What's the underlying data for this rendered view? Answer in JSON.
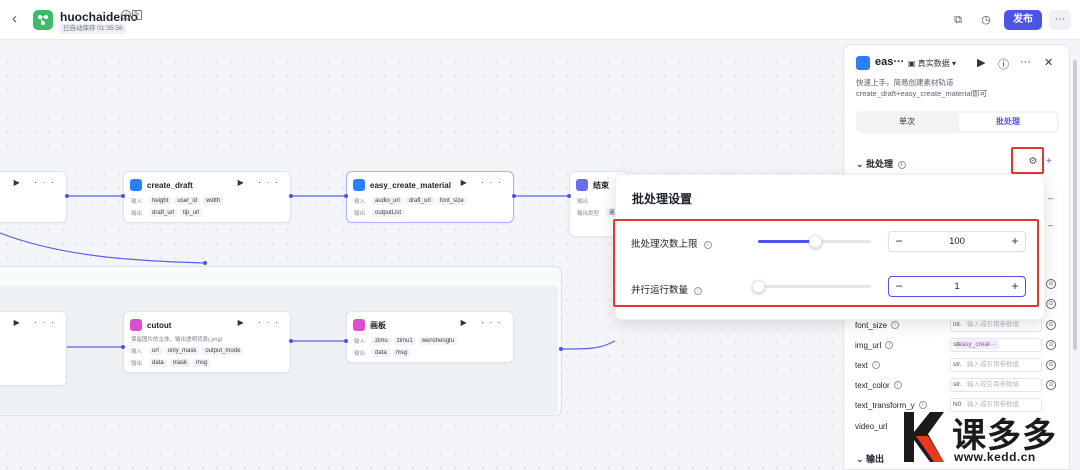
{
  "header": {
    "title": "huochaidemo",
    "autosave": "已自动保存 01:35:56",
    "publish_label": "发布"
  },
  "nodes": {
    "create_draft": {
      "title": "create_draft",
      "in_label": "输入",
      "out_label": "输出",
      "inputs": [
        "height",
        "user_id",
        "width"
      ],
      "outputs": [
        "draft_url",
        "tip_url"
      ]
    },
    "easy_create_material": {
      "title": "easy_create_material",
      "in_label": "输入",
      "out_label": "输出",
      "inputs": [
        "audio_url",
        "draft_url",
        "font_size"
      ],
      "outputs": [
        "outputList"
      ]
    },
    "end": {
      "title": "结束",
      "in_label": "输出",
      "out_label": "输出类型",
      "out_value": "返回"
    },
    "cutout": {
      "title": "cutout",
      "desc": "保留图片的主体，输出透明背景(.png)",
      "in_label": "输入",
      "out_label": "输出",
      "inputs": [
        "url",
        "only_mask",
        "output_mode"
      ],
      "outputs": [
        "data",
        "mask",
        "msg"
      ]
    },
    "canvas": {
      "title": "画板",
      "in_label": "输入",
      "out_label": "输出",
      "inputs": [
        "zimu",
        "zimu1",
        "wenshengtu"
      ],
      "outputs": [
        "data",
        "msg"
      ]
    }
  },
  "popover": {
    "title": "批处理设置",
    "rows": [
      {
        "label": "批处理次数上限",
        "value": "100",
        "fraction": 0.5
      },
      {
        "label": "并行运行数量",
        "value": "1",
        "fraction": 0.0
      }
    ]
  },
  "panel": {
    "title": "eas···",
    "tag": "真实数据",
    "description": "快速上手，简易创建素材轨道 create_draft+easy_create_material即可",
    "tabs": [
      "单次",
      "批处理"
    ],
    "active_tab": "批处理",
    "section": "批处理",
    "params": [
      {
        "name": "font_size",
        "type": "int.",
        "placeholder": "输入或引用参数值"
      },
      {
        "name": "img_url",
        "type": "str.",
        "chip": "easy_creat···"
      },
      {
        "name": "text",
        "type": "str.",
        "placeholder": "输入或引用参数值"
      },
      {
        "name": "text_color",
        "type": "str.",
        "placeholder": "输入或引用参数值"
      },
      {
        "name": "text_transform_y",
        "type": "N0",
        "placeholder": "输入或引用参数值"
      },
      {
        "name": "video_url",
        "type": "",
        "placeholder": ""
      }
    ],
    "output_section": "输出"
  },
  "watermark": {
    "brand": "课多多",
    "url": "www.kedd.cn"
  }
}
